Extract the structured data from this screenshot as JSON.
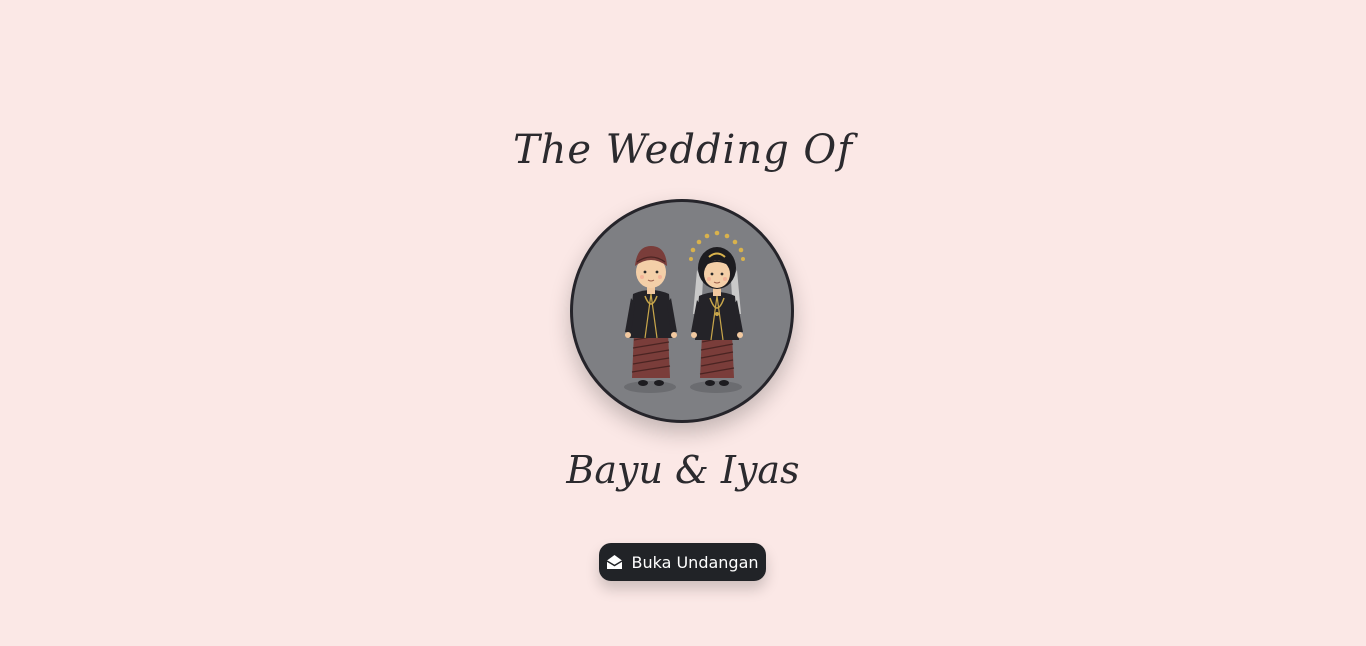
{
  "header": {
    "title": "The Wedding Of"
  },
  "couple": {
    "names": "Bayu & Iyas"
  },
  "action": {
    "open_label": "Buka Undangan",
    "open_icon": "envelope-open-icon"
  },
  "colors": {
    "background": "#fbe8e6",
    "text": "#2b2a2e",
    "button": "#212327",
    "photo_bg": "#7e7f83"
  }
}
